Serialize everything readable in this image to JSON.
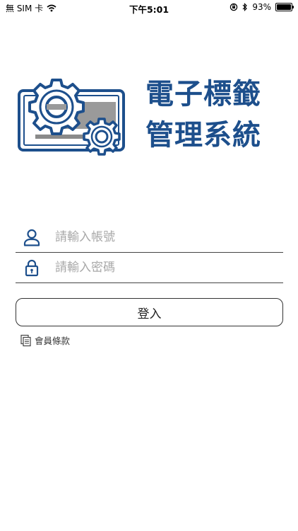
{
  "status_bar": {
    "carrier": "無 SIM 卡",
    "time": "下午5:01",
    "battery": "93%",
    "battery_level": 0.93
  },
  "logo": {
    "title_line1": "電子標籤",
    "title_line2": "管理系統",
    "brand_color": "#1d4f8c"
  },
  "form": {
    "username_placeholder": "請輸入帳號",
    "password_placeholder": "請輸入密碼",
    "username_value": "",
    "password_value": "",
    "login_label": "登入",
    "terms_label": "會員條款",
    "icon_color": "#1d4f8c"
  }
}
